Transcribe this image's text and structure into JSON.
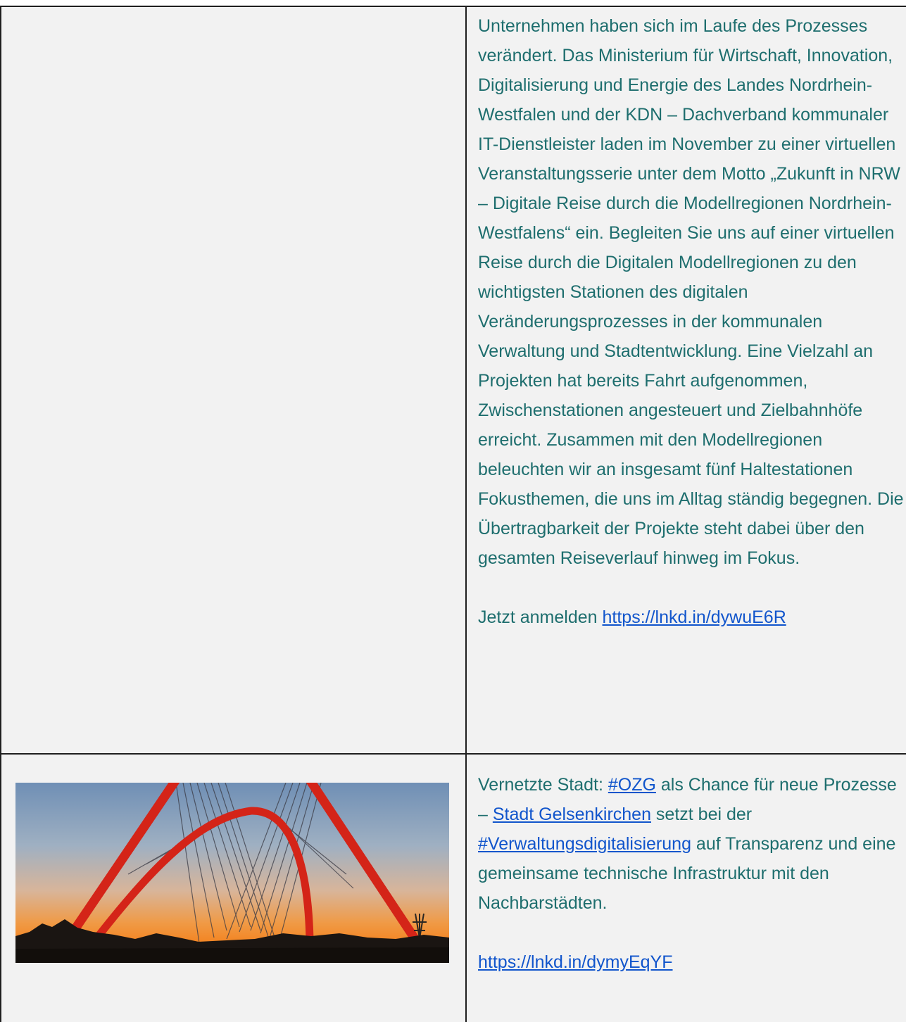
{
  "row1": {
    "body_text": "Unternehmen haben sich im Laufe des Prozesses verändert. Das Ministerium für Wirtschaft, Innovation, Digitalisierung und Energie des Landes Nordrhein-Westfalen und der KDN – Dachverband kommunaler IT-Dienstleister laden im November zu einer virtuellen Veranstaltungsserie unter dem Motto „Zukunft in NRW – Digitale Reise durch die Modellregionen Nordrhein-Westfalens“ ein. Begleiten Sie uns auf einer virtuellen Reise durch die Digitalen Modellregionen zu den wichtigsten Stationen des digitalen Veränderungsprozesses in der kommunalen Verwaltung und Stadtentwicklung. Eine Vielzahl an Projekten hat bereits Fahrt aufgenommen, Zwischenstationen angesteuert und Zielbahnhöfe erreicht. Zusammen mit den Modellregionen beleuchten wir an insgesamt fünf Haltestationen Fokusthemen, die uns im Alltag ständig begegnen. Die Übertragbarkeit der Projekte steht dabei über den gesamten Reiseverlauf hinweg im Fokus.",
    "register_prefix": "Jetzt anmelden ",
    "register_link": "https://lnkd.in/dywuE6R"
  },
  "row2": {
    "text_1": "Vernetzte Stadt: ",
    "link_ozg": "#OZG",
    "text_2": " als Chance für neue Prozesse – ",
    "link_city": "Stadt Gelsenkirchen",
    "text_3": " setzt bei der ",
    "link_digital": "#Verwaltungsdigitalisierung",
    "text_4": " auf Transparenz und eine gemeinsame technische Infrastruktur mit den Nachbarstädten.",
    "url_link": "https://lnkd.in/dymyEqYF"
  },
  "colors": {
    "text": "#1e6e6e",
    "link": "#1155cc",
    "cell_background": "#f2f2f2",
    "border": "#1f1f1f",
    "bridge_arch": "#d42418"
  }
}
